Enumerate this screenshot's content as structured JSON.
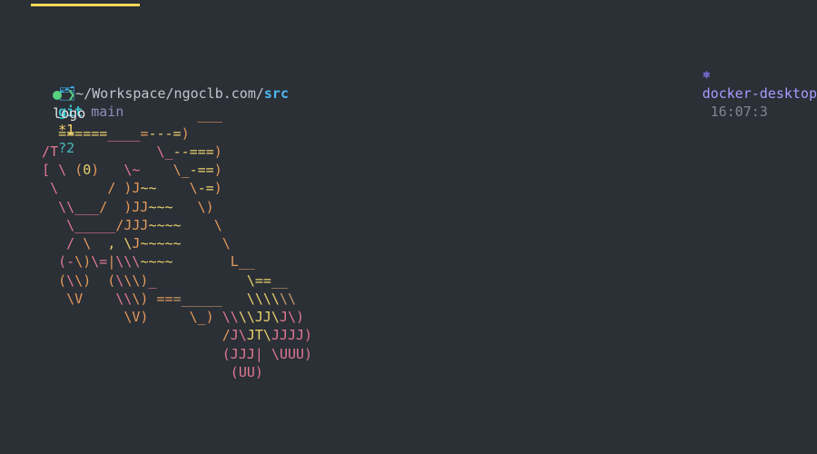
{
  "prompt": {
    "apple_glyph": "",
    "folder_glyph": "🗂",
    "path_prefix": "~/Workspace/ngoclb.com/",
    "path_dir": "src",
    "git_label": "git",
    "branch": "main",
    "modified": "*1",
    "untracked": "?2",
    "kube_glyph": "⎈",
    "context": "docker-desktop",
    "time": "16:07:3",
    "prompt_symbol": "❯",
    "command": "logo"
  },
  "logo": {
    "l01": {
      "a": "                     ",
      "b": "___"
    },
    "l02": {
      "a": "    ",
      "b": "======",
      "c": "____",
      "d": "=",
      "e": "---=",
      "f": ")"
    },
    "l03": {
      "a": "  /T            \\_",
      "b": "--===",
      "c": ")"
    },
    "l04": {
      "a": "  ",
      "b": "[ \\ ",
      "c": "(",
      "d": "0",
      "e": ")   ",
      "f": "\\~    ",
      "g": "\\_",
      "h": "-==",
      "i": ")"
    },
    "l05": {
      "a": "   ",
      "b": "\\      ",
      "c": "/ )J",
      "d": "~~    ",
      "e": "\\",
      "f": "-=",
      "g": ")"
    },
    "l06": {
      "a": "    ",
      "b": "\\\\___",
      "c": "/  )JJ",
      "d": "~",
      "e": "~~   ",
      "f": "\\)"
    },
    "l07": {
      "a": "     ",
      "b": "\\_____",
      "c": "/JJJ",
      "d": "~~",
      "e": "~~    ",
      "f": "\\"
    },
    "l08": {
      "a": "     /",
      "b": " ",
      "c": "\\  ",
      "d": ", \\",
      "e": "J",
      "f": "~~~",
      "g": "~~     ",
      "h": "\\"
    },
    "l09": {
      "a": "    (-",
      "b": "\\)",
      "c": "\\=",
      "d": "|",
      "e": "\\\\\\",
      "f": "~~",
      "g": "~~       ",
      "h": "L_",
      "i": "_"
    },
    "l10": {
      "a": "    ",
      "b": "(",
      "c": "\\",
      "d": "\\)  (",
      "e": "\\",
      "f": "\\\\)",
      "g": "_           ",
      "h": "\\==",
      "i": "__"
    },
    "l11": {
      "a": "     ",
      "b": "\\V    ",
      "c": "\\\\",
      "d": "\\) ==",
      "e": "=_____   ",
      "f": "\\\\\\\\",
      "g": "\\\\"
    },
    "l12": {
      "a": "            ",
      "b": "\\V)     \\_) ",
      "c": "\\\\",
      "d": "\\\\JJ\\",
      "e": "J\\)"
    },
    "l13": {
      "a": "                        ",
      "b": "/",
      "c": "J\\",
      "d": "JT\\",
      "e": "JJJJ)"
    },
    "l14": {
      "a": "                        (J",
      "b": "JJ| \\UUU)"
    },
    "l15": {
      "a": "                         (",
      "b": "UU)"
    }
  }
}
